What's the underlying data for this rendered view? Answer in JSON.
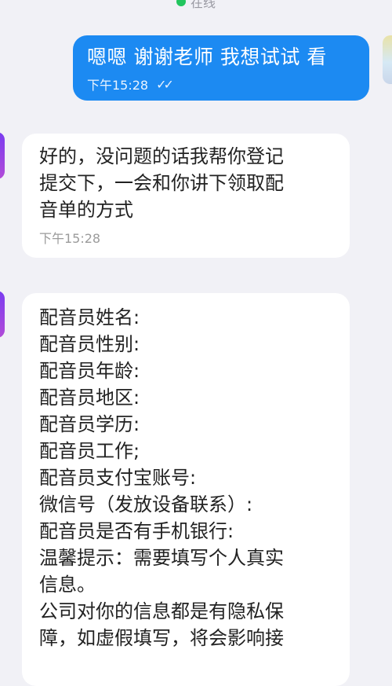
{
  "header": {
    "status_text": "在线"
  },
  "messages": [
    {
      "direction": "outgoing",
      "text": "嗯嗯 谢谢老师 我想试试 看",
      "time": "下午15:28",
      "read_indicator": "double-check-icon"
    },
    {
      "direction": "incoming",
      "lines": [
        "好的，没问题的话我帮你登记",
        "提交下，一会和你讲下领取配",
        "音单的方式"
      ],
      "time": "下午15:28"
    },
    {
      "direction": "incoming",
      "lines": [
        "配音员姓名:",
        "配音员性别:",
        "配音员年龄:",
        "配音员地区:",
        "配音员学历:",
        "配音员工作;",
        "配音员支付宝账号:",
        "微信号（发放设备联系）:",
        "配音员是否有手机银行:",
        "温馨提示：需要填写个人真实",
        "信息。",
        "公司对你的信息都是有隐私保",
        "障，如虚假填写，将会影响接"
      ]
    }
  ],
  "colors": {
    "outgoing_bubble": "#1c8af2",
    "incoming_bubble": "#ffffff",
    "background": "#f1f1f6",
    "online_dot": "#22c55e"
  }
}
